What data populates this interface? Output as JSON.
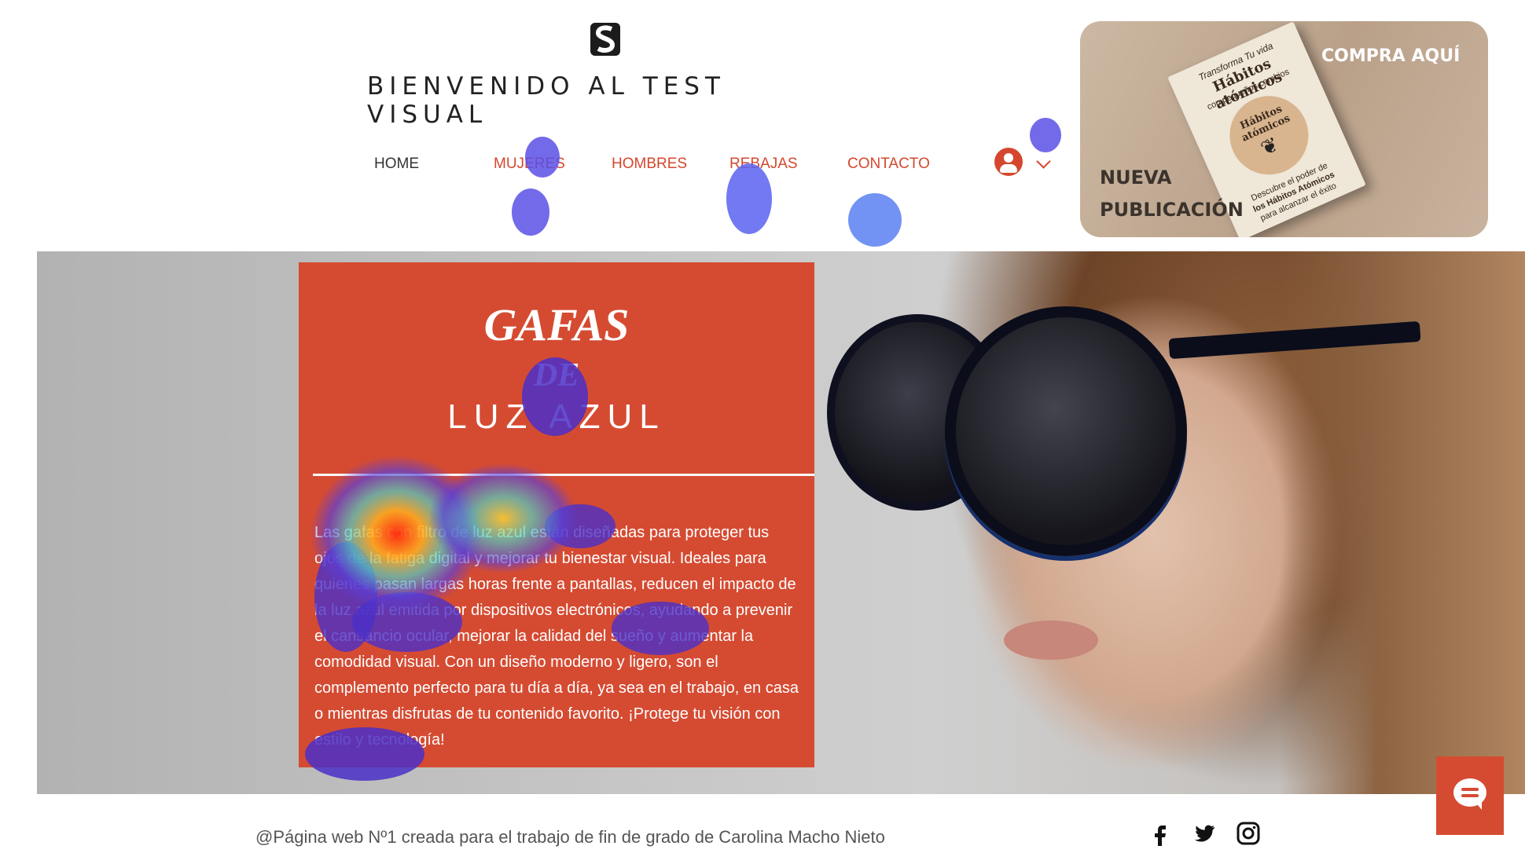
{
  "header": {
    "title": "BIENVENIDO AL TEST VISUAL",
    "nav": [
      {
        "label": "HOME",
        "color": "#333333"
      },
      {
        "label": "MUJERES",
        "color": "#d4472e"
      },
      {
        "label": "HOMBRES",
        "color": "#d4472e"
      },
      {
        "label": "REBAJAS",
        "color": "#d4472e"
      },
      {
        "label": "CONTACTO",
        "color": "#d4472e"
      }
    ]
  },
  "ad": {
    "buy_label": "COMPRA AQUÍ",
    "new_line1": "NUEVA",
    "new_line2": "PUBLICACIÓN",
    "book": {
      "top": "Transforma Tu vida",
      "title": "Hábitos atómicos",
      "subtitle": "con pequeños cambios",
      "center": "Hábitos atómicos",
      "bottom1": "Descubre el poder de",
      "bottom2": "los Hábitos Atómicos",
      "bottom3": "para alcanzar el éxito"
    }
  },
  "hero": {
    "title_line1": "GAFAS",
    "title_line2": "DE",
    "title_line3": "LUZ AZUL",
    "body": "Las gafas con filtro de luz azul están diseñadas para proteger tus ojos de la fatiga digital y mejorar tu bienestar visual. Ideales para quienes pasan largas horas frente a pantallas, reducen el impacto de la luz azul emitida por dispositivos electrónicos, ayudando a prevenir el cansancio ocular, mejorar la calidad del sueño y aumentar la comodidad visual. Con un diseño moderno y ligero, son el complemento perfecto para tu día a día, ya sea en el trabajo, en casa o mientras disfrutas de tu contenido favorito. ¡Protege tu visión con estilo y tecnología!"
  },
  "footer": {
    "text": "@Página web Nº1 creada para el trabajo de fin de grado de Carolina Macho Nieto",
    "social": [
      "facebook-icon",
      "twitter-icon",
      "instagram-icon"
    ]
  },
  "colors": {
    "accent": "#d54b32",
    "heat_low": "#5a4fdc",
    "heat_mid": "#4fd1c5",
    "heat_high": "#ff3a1a"
  }
}
